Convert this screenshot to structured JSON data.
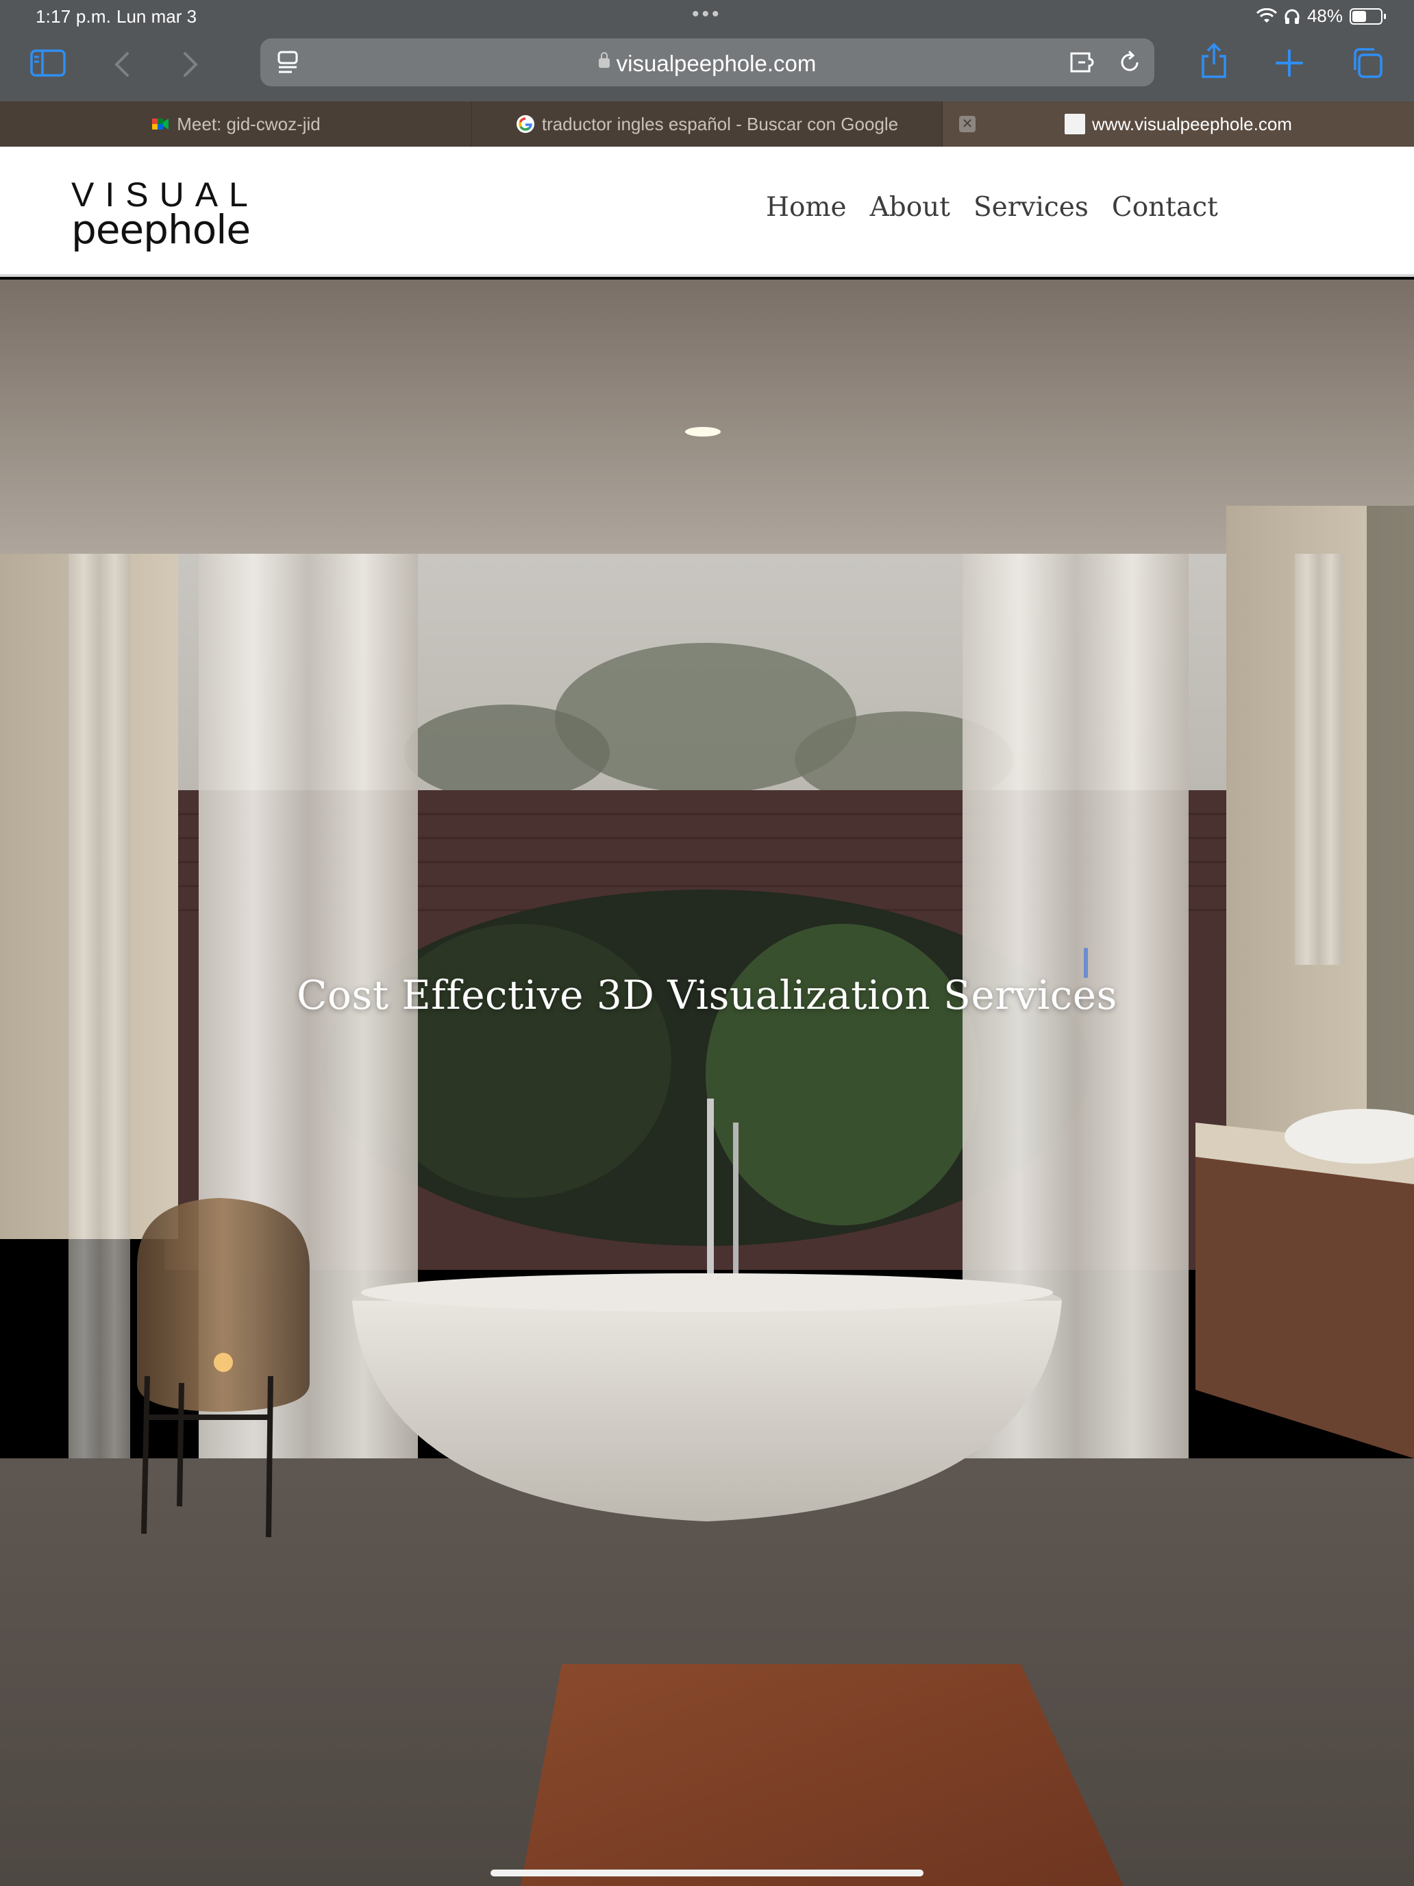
{
  "status_bar": {
    "time": "1:17 p.m.",
    "date": "Lun mar 3",
    "battery": "48%"
  },
  "browser": {
    "address": "visualpeephole.com",
    "tabs": [
      {
        "title": "Meet: gid-cwoz-jid",
        "icon": "google-meet-icon"
      },
      {
        "title": "traductor ingles español - Buscar con Google",
        "icon": "google-icon"
      },
      {
        "title": "www.visualpeephole.com",
        "icon": "page-icon",
        "active": true
      }
    ]
  },
  "site": {
    "logo_top": "VISUAL",
    "logo_bottom": "peephole",
    "nav": [
      "Home",
      "About",
      "Services",
      "Contact"
    ],
    "hero_title": "Cost Effective 3D Visualization Services"
  },
  "colors": {
    "safari_chrome": "#54575a",
    "tab_bar": "#4a3f36",
    "accent_blue": "#2f8ff5"
  }
}
